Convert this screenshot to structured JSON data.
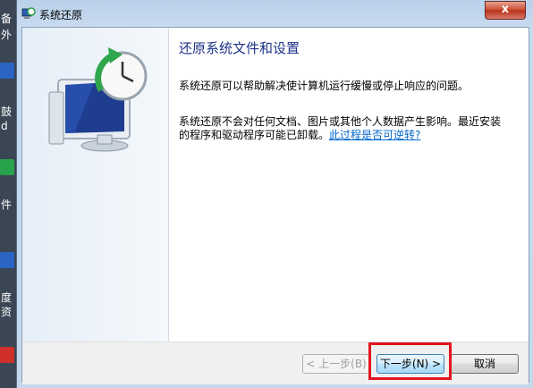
{
  "desktop": {
    "labels": [
      "备",
      "外",
      "鼓",
      "d",
      "件",
      "度",
      "资"
    ]
  },
  "window": {
    "title": "系统还原",
    "close_label": "x"
  },
  "content": {
    "heading": "还原系统文件和设置",
    "para1": "系统还原可以帮助解决使计算机运行缓慢或停止响应的问题。",
    "para2": "系统还原不会对任何文档、图片或其他个人数据产生影响。最近安装的程序和驱动程序可能已卸载。",
    "link": "此过程是否可逆转?"
  },
  "buttons": {
    "back": "< 上一步(B)",
    "next": "下一步(N) >",
    "cancel": "取消"
  },
  "colors": {
    "heading": "#1e3287",
    "link": "#0066cc",
    "highlight": "#e3141e"
  }
}
